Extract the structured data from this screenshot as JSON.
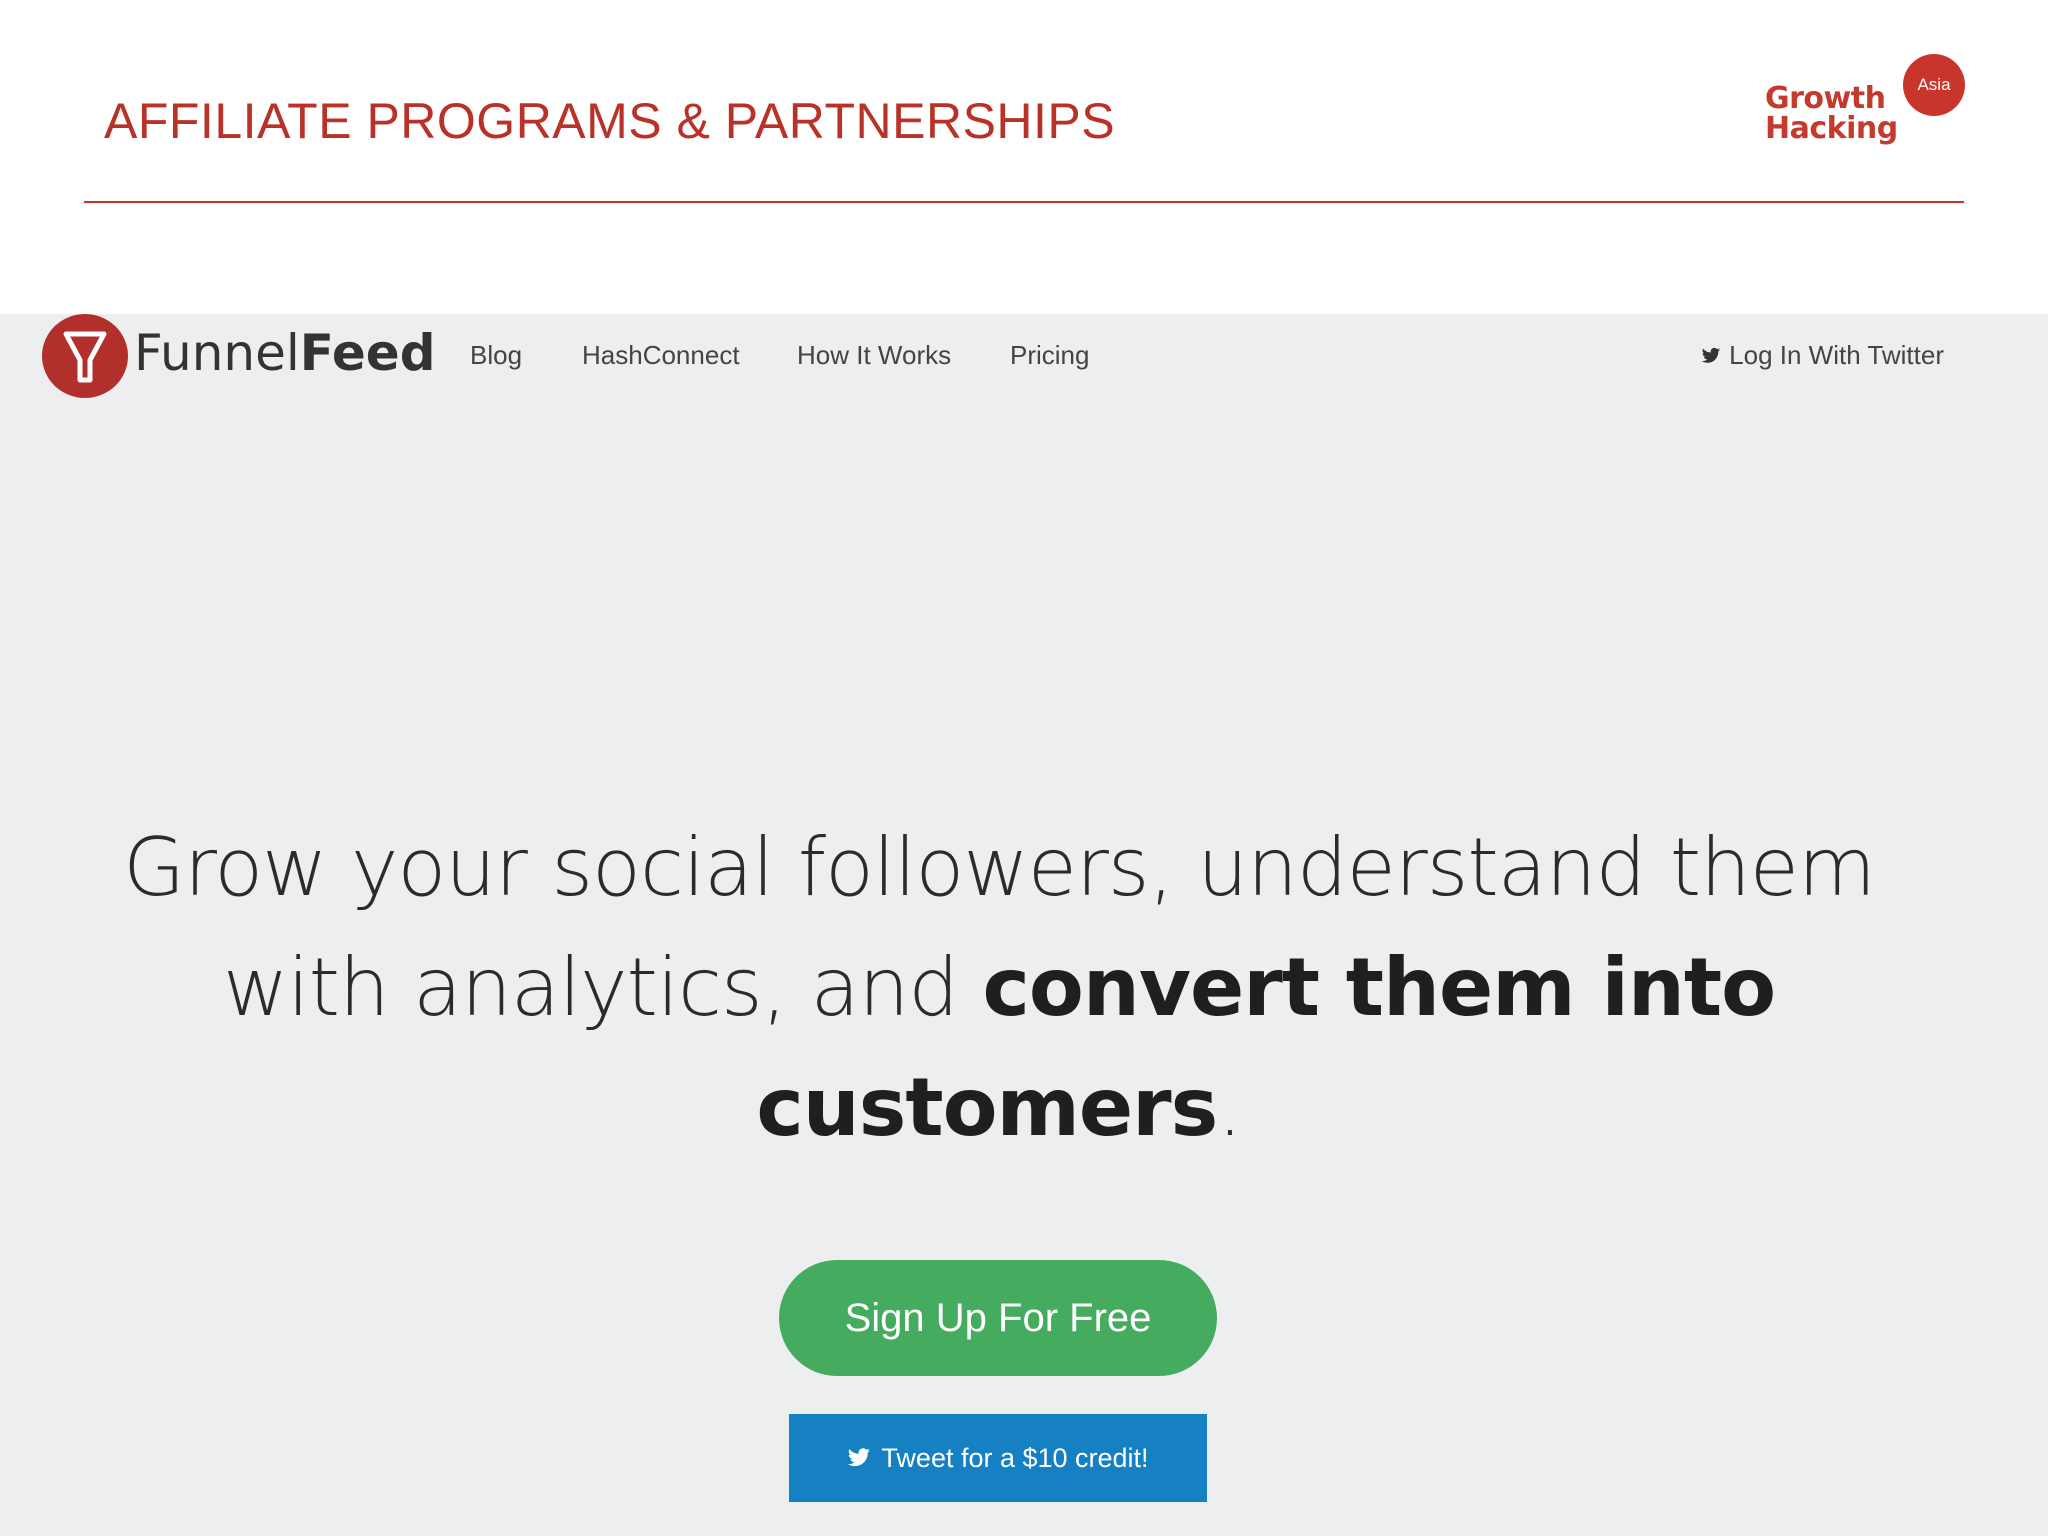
{
  "slide": {
    "title": "AFFILIATE PROGRAMS & PARTNERSHIPS",
    "brand": {
      "line1": "Growth",
      "line2": "Hacking",
      "badge": "Asia"
    }
  },
  "site": {
    "logo": {
      "word_light": "Funnel",
      "word_bold": "Feed",
      "icon": "funnel-icon"
    },
    "nav": {
      "items": [
        {
          "label": "Blog"
        },
        {
          "label": "HashConnect"
        },
        {
          "label": "How It Works"
        },
        {
          "label": "Pricing"
        }
      ],
      "login_label": "Log In With Twitter",
      "login_icon": "twitter-bird-icon"
    },
    "hero": {
      "headline_part1": "Grow your social followers, understand them with analytics, and ",
      "headline_strong": "convert them into customers",
      "headline_end": ".",
      "signup_label": "Sign Up For Free",
      "tweet_label": "Tweet for a $10 credit!",
      "tweet_icon": "twitter-bird-icon"
    }
  },
  "colors": {
    "accent_red": "#b83227",
    "screenshot_bg": "#eceef0",
    "signup_green": "#44ab5f",
    "tweet_blue": "#1580c2"
  }
}
